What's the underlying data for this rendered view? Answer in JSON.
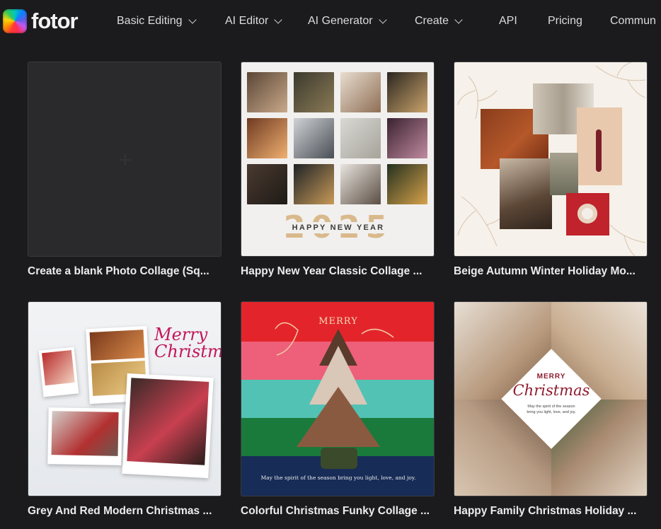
{
  "brand": {
    "name": "fotor"
  },
  "nav": {
    "items": [
      {
        "label": "Basic Editing",
        "dropdown": true
      },
      {
        "label": "AI Editor",
        "dropdown": true
      },
      {
        "label": "AI Generator",
        "dropdown": true
      },
      {
        "label": "Create",
        "dropdown": true
      },
      {
        "label": "API",
        "dropdown": false
      },
      {
        "label": "Pricing",
        "dropdown": false
      },
      {
        "label": "Commun",
        "dropdown": false
      }
    ]
  },
  "templates": [
    {
      "title": "Create a blank Photo Collage (Sq..."
    },
    {
      "title": "Happy New Year Classic Collage ...",
      "year": "2025",
      "caption": "HAPPY NEW YEAR"
    },
    {
      "title": "Beige Autumn Winter Holiday Mo..."
    },
    {
      "title": "Grey And Red Modern Christmas ...",
      "script": "Merry Christmas!"
    },
    {
      "title": "Colorful Christmas Funky Collage ...",
      "heading": "MERRY",
      "footer": "May the spirit of the season bring you light, love, and joy."
    },
    {
      "title": "Happy Family Christmas Holiday ...",
      "heading": "MERRY",
      "script": "Christmas",
      "subtitle": "May the spirit of the season bring you light, love, and joy."
    }
  ],
  "colors": {
    "background": "#1b1b1d",
    "card_border": "#3a3a3e",
    "text": "#ececee"
  }
}
